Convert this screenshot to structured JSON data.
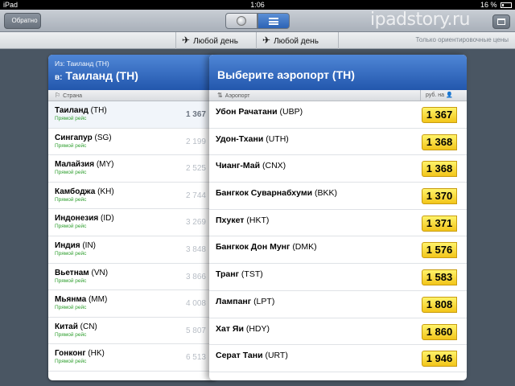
{
  "status_bar": {
    "device": "iPad",
    "time": "1:06",
    "battery": "16 %"
  },
  "toolbar": {
    "back_label": "Обратно",
    "watermark": "ipadstory.ru"
  },
  "date_bar": {
    "depart_label": "Любой день",
    "return_label": "Любой день",
    "note": "Только ориентировочные цены"
  },
  "left_panel": {
    "from_label": "Из: Таиланд (TH)",
    "to_prefix": "в:",
    "to_label": "Таиланд (TH)",
    "column_header": "Страна",
    "countries": [
      {
        "name": "Таиланд",
        "code": "(TH)",
        "direct": "Прямой рейс",
        "price": "1 367"
      },
      {
        "name": "Сингапур",
        "code": "(SG)",
        "direct": "Прямой рейс",
        "price": "2 199"
      },
      {
        "name": "Малайзия",
        "code": "(MY)",
        "direct": "Прямой рейс",
        "price": "2 525"
      },
      {
        "name": "Камбоджа",
        "code": "(KH)",
        "direct": "Прямой рейс",
        "price": "2 744"
      },
      {
        "name": "Индонезия",
        "code": "(ID)",
        "direct": "Прямой рейс",
        "price": "3 269"
      },
      {
        "name": "Индия",
        "code": "(IN)",
        "direct": "Прямой рейс",
        "price": "3 848"
      },
      {
        "name": "Вьетнам",
        "code": "(VN)",
        "direct": "Прямой рейс",
        "price": "3 866"
      },
      {
        "name": "Мьянма",
        "code": "(MM)",
        "direct": "Прямой рейс",
        "price": "4 008"
      },
      {
        "name": "Китай",
        "code": "(CN)",
        "direct": "Прямой рейс",
        "price": "5 807"
      },
      {
        "name": "Гонконг",
        "code": "(HK)",
        "direct": "Прямой рейс",
        "price": "6 513"
      }
    ]
  },
  "right_panel": {
    "title": "Выберите аэропорт (TH)",
    "column_header": "Аэропорт",
    "price_header": "руб. на",
    "airports": [
      {
        "name": "Убон Рачатани",
        "code": "(UBP)",
        "price": "1 367"
      },
      {
        "name": "Удон-Тхани",
        "code": "(UTH)",
        "price": "1 368"
      },
      {
        "name": "Чианг-Май",
        "code": "(CNX)",
        "price": "1 368"
      },
      {
        "name": "Бангкок Суварнабхуми",
        "code": "(BKK)",
        "price": "1 370"
      },
      {
        "name": "Пхукет",
        "code": "(HKT)",
        "price": "1 371"
      },
      {
        "name": "Бангкок Дон Мунг",
        "code": "(DMK)",
        "price": "1 576"
      },
      {
        "name": "Транг",
        "code": "(TST)",
        "price": "1 583"
      },
      {
        "name": "Лампанг",
        "code": "(LPT)",
        "price": "1 808"
      },
      {
        "name": "Хат Яи",
        "code": "(HDY)",
        "price": "1 860"
      },
      {
        "name": "Серат Тани",
        "code": "(URT)",
        "price": "1 946"
      }
    ]
  },
  "colors": {
    "header_blue": "#2f67bf",
    "direct_green": "#2e9e2e",
    "price_yellow": "#f7d82c"
  }
}
